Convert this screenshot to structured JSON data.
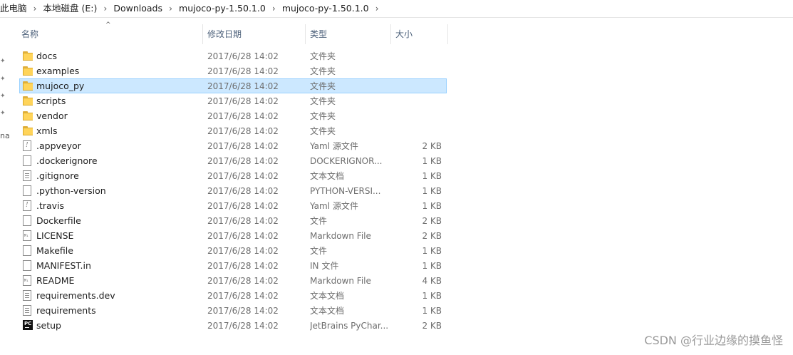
{
  "breadcrumb": [
    "此电脑",
    "本地磁盘 (E:)",
    "Downloads",
    "mujoco-py-1.50.1.0",
    "mujoco-py-1.50.1.0"
  ],
  "columns": {
    "name": "名称",
    "date": "修改日期",
    "type": "类型",
    "size": "大小"
  },
  "left_fragment": "na",
  "rows": [
    {
      "name": "docs",
      "date": "2017/6/28 14:02",
      "type": "文件夹",
      "size": "",
      "icon": "folder-icon"
    },
    {
      "name": "examples",
      "date": "2017/6/28 14:02",
      "type": "文件夹",
      "size": "",
      "icon": "folder-icon"
    },
    {
      "name": "mujoco_py",
      "date": "2017/6/28 14:02",
      "type": "文件夹",
      "size": "",
      "icon": "folder-icon",
      "selected": true
    },
    {
      "name": "scripts",
      "date": "2017/6/28 14:02",
      "type": "文件夹",
      "size": "",
      "icon": "folder-icon"
    },
    {
      "name": "vendor",
      "date": "2017/6/28 14:02",
      "type": "文件夹",
      "size": "",
      "icon": "folder-icon"
    },
    {
      "name": "xmls",
      "date": "2017/6/28 14:02",
      "type": "文件夹",
      "size": "",
      "icon": "folder-icon"
    },
    {
      "name": ".appveyor",
      "date": "2017/6/28 14:02",
      "type": "Yaml 源文件",
      "size": "2 KB",
      "icon": "yaml-file-icon"
    },
    {
      "name": ".dockerignore",
      "date": "2017/6/28 14:02",
      "type": "DOCKERIGNOR...",
      "size": "1 KB",
      "icon": "blank-file-icon"
    },
    {
      "name": ".gitignore",
      "date": "2017/6/28 14:02",
      "type": "文本文档",
      "size": "1 KB",
      "icon": "text-file-icon"
    },
    {
      "name": ".python-version",
      "date": "2017/6/28 14:02",
      "type": "PYTHON-VERSI...",
      "size": "1 KB",
      "icon": "blank-file-icon"
    },
    {
      "name": ".travis",
      "date": "2017/6/28 14:02",
      "type": "Yaml 源文件",
      "size": "1 KB",
      "icon": "yaml-file-icon"
    },
    {
      "name": "Dockerfile",
      "date": "2017/6/28 14:02",
      "type": "文件",
      "size": "2 KB",
      "icon": "blank-file-icon"
    },
    {
      "name": "LICENSE",
      "date": "2017/6/28 14:02",
      "type": "Markdown File",
      "size": "2 KB",
      "icon": "markdown-file-icon"
    },
    {
      "name": "Makefile",
      "date": "2017/6/28 14:02",
      "type": "文件",
      "size": "1 KB",
      "icon": "blank-file-icon"
    },
    {
      "name": "MANIFEST.in",
      "date": "2017/6/28 14:02",
      "type": "IN 文件",
      "size": "1 KB",
      "icon": "blank-file-icon"
    },
    {
      "name": "README",
      "date": "2017/6/28 14:02",
      "type": "Markdown File",
      "size": "4 KB",
      "icon": "markdown-file-icon"
    },
    {
      "name": "requirements.dev",
      "date": "2017/6/28 14:02",
      "type": "文本文档",
      "size": "1 KB",
      "icon": "text-file-icon"
    },
    {
      "name": "requirements",
      "date": "2017/6/28 14:02",
      "type": "文本文档",
      "size": "1 KB",
      "icon": "text-file-icon"
    },
    {
      "name": "setup",
      "date": "2017/6/28 14:02",
      "type": "JetBrains PyChar...",
      "size": "2 KB",
      "icon": "pycharm-file-icon"
    }
  ],
  "watermark": "CSDN @行业边缘的摸鱼怪"
}
